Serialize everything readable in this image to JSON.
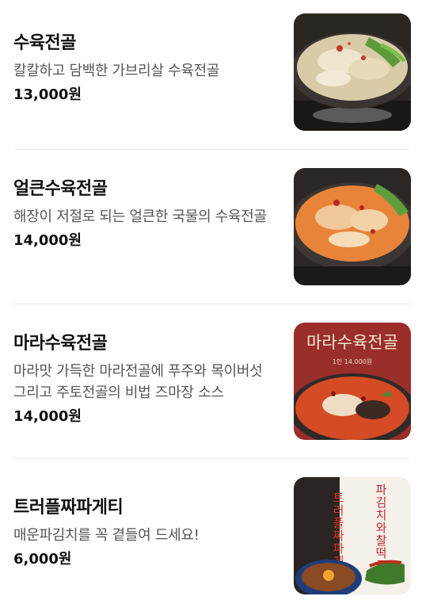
{
  "menu": {
    "items": [
      {
        "name": "수육전골",
        "description": "칼칼하고 담백한 가브리살 수육전골",
        "price": "13,000원",
        "image_icon": "hotpot-photo"
      },
      {
        "name": "얼큰수육전골",
        "description": "해장이 저절로 되는 얼큰한 국물의 수육전골",
        "price": "14,000원",
        "image_icon": "spicy-hotpot-photo"
      },
      {
        "name": "마라수육전골",
        "description": "마라맛 가득한 마라전골에 푸주와 목이버섯 그리고 주토전골의 비법 즈마장 소스",
        "price": "14,000원",
        "image_icon": "mala-hotpot-poster",
        "image_title": "마라수육전골",
        "image_subtitle": "1인 14,000원"
      },
      {
        "name": "트러플짜파게티",
        "description": "매운파김치를 꼭 곁들여 드세요!",
        "price": "6,000원",
        "image_icon": "truffle-noodle-poster",
        "image_left_text": "트러플짜파게티",
        "image_right_text": "파김치와찰떡궁합"
      }
    ]
  }
}
